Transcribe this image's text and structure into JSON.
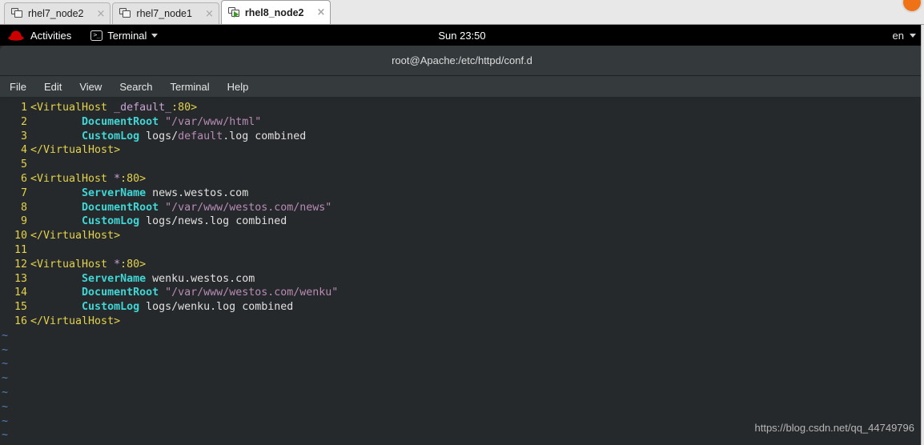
{
  "vm_tabs": [
    {
      "label": "rhel7_node2",
      "icon": "vm-screen-icon",
      "active": false,
      "close": "×",
      "running": false
    },
    {
      "label": "rhel7_node1",
      "icon": "vm-screen-icon",
      "active": false,
      "close": "×",
      "running": false
    },
    {
      "label": "rhel8_node2",
      "icon": "vm-screen-play-icon",
      "active": true,
      "close": "×",
      "running": true
    }
  ],
  "gnome_bar": {
    "logo_icon": "red-hat-logo-icon",
    "activities": "Activities",
    "app_icon": "terminal-icon",
    "app_menu": "Terminal",
    "app_menu_caret": "chevron-down-icon",
    "clock": "Sun 23:50",
    "keyboard_layout": "en",
    "keyboard_caret": "chevron-down-icon"
  },
  "terminal": {
    "title": "root@Apache:/etc/httpd/conf.d",
    "menu": [
      "File",
      "Edit",
      "View",
      "Search",
      "Terminal",
      "Help"
    ],
    "tilde_glyph": "~",
    "tilde_count": 8,
    "lines": [
      {
        "n": "1",
        "parts": [
          {
            "t": "<VirtualHost ",
            "c": "s-tag"
          },
          {
            "t": "_default_",
            "c": "s-arg"
          },
          {
            "t": ":80>",
            "c": "s-tag"
          }
        ]
      },
      {
        "n": "2",
        "parts": [
          {
            "t": "        ",
            "c": "s-plain"
          },
          {
            "t": "DocumentRoot",
            "c": "s-dir"
          },
          {
            "t": " ",
            "c": "s-plain"
          },
          {
            "t": "\"/var/www/html\"",
            "c": "s-str"
          }
        ]
      },
      {
        "n": "3",
        "parts": [
          {
            "t": "        ",
            "c": "s-plain"
          },
          {
            "t": "CustomLog",
            "c": "s-dir"
          },
          {
            "t": " logs/",
            "c": "s-plain"
          },
          {
            "t": "default",
            "c": "s-str"
          },
          {
            "t": ".log combined",
            "c": "s-plain"
          }
        ]
      },
      {
        "n": "4",
        "parts": [
          {
            "t": "</VirtualHost>",
            "c": "s-tag"
          }
        ]
      },
      {
        "n": "5",
        "parts": []
      },
      {
        "n": "6",
        "parts": [
          {
            "t": "<VirtualHost ",
            "c": "s-tag"
          },
          {
            "t": "*",
            "c": "s-arg"
          },
          {
            "t": ":80>",
            "c": "s-tag"
          }
        ]
      },
      {
        "n": "7",
        "parts": [
          {
            "t": "        ",
            "c": "s-plain"
          },
          {
            "t": "ServerName",
            "c": "s-dir"
          },
          {
            "t": " news.westos.com",
            "c": "s-plain"
          }
        ]
      },
      {
        "n": "8",
        "parts": [
          {
            "t": "        ",
            "c": "s-plain"
          },
          {
            "t": "DocumentRoot",
            "c": "s-dir"
          },
          {
            "t": " ",
            "c": "s-plain"
          },
          {
            "t": "\"/var/www/westos.com/news\"",
            "c": "s-str"
          }
        ]
      },
      {
        "n": "9",
        "parts": [
          {
            "t": "        ",
            "c": "s-plain"
          },
          {
            "t": "CustomLog",
            "c": "s-dir"
          },
          {
            "t": " logs/news.log combined",
            "c": "s-plain"
          }
        ]
      },
      {
        "n": "10",
        "parts": [
          {
            "t": "</VirtualHost>",
            "c": "s-tag"
          }
        ]
      },
      {
        "n": "11",
        "parts": []
      },
      {
        "n": "12",
        "parts": [
          {
            "t": "<VirtualHost ",
            "c": "s-tag"
          },
          {
            "t": "*",
            "c": "s-arg"
          },
          {
            "t": ":80>",
            "c": "s-tag"
          }
        ]
      },
      {
        "n": "13",
        "parts": [
          {
            "t": "        ",
            "c": "s-plain"
          },
          {
            "t": "ServerName",
            "c": "s-dir"
          },
          {
            "t": " wenku.westos.com",
            "c": "s-plain"
          }
        ]
      },
      {
        "n": "14",
        "parts": [
          {
            "t": "        ",
            "c": "s-plain"
          },
          {
            "t": "DocumentRoot",
            "c": "s-dir"
          },
          {
            "t": " ",
            "c": "s-plain"
          },
          {
            "t": "\"/var/www/westos.com/wenku\"",
            "c": "s-str"
          }
        ]
      },
      {
        "n": "15",
        "parts": [
          {
            "t": "        ",
            "c": "s-plain"
          },
          {
            "t": "CustomLog",
            "c": "s-dir"
          },
          {
            "t": " logs/wenku.log combined",
            "c": "s-plain"
          }
        ]
      },
      {
        "n": "16",
        "parts": [
          {
            "t": "</VirtualHost>",
            "c": "s-tag"
          }
        ]
      }
    ]
  },
  "watermark": "https://blog.csdn.net/qq_44749796",
  "colors": {
    "linenum": "#e3d24b",
    "tag": "#e3d24b",
    "directive": "#3fd6d6",
    "string": "#b98bb5",
    "arg": "#c9a3d4",
    "tilde": "#5880b5",
    "terminal_bg": "#26292b",
    "titlebar_bg": "#343a3c",
    "gnome_bar_bg": "#000000",
    "redhat_red": "#cc0000",
    "running_green": "#3a9b23",
    "badge_orange": "#ef7216"
  }
}
